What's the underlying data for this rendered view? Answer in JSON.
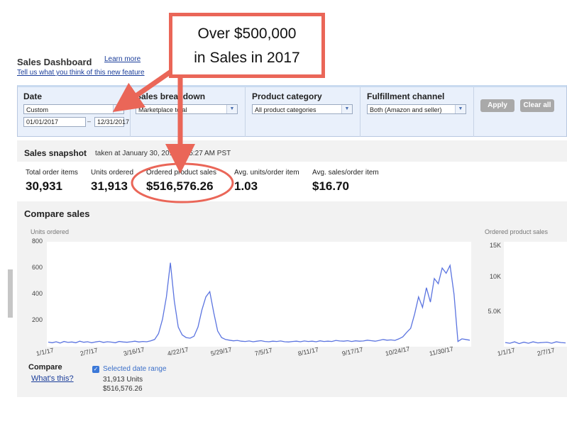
{
  "header": {
    "title": "Sales Dashboard",
    "learn_more": "Learn more",
    "feedback": "Tell us what you think of this new feature"
  },
  "filters": {
    "date": {
      "label": "Date",
      "preset": "Custom",
      "start": "01/01/2017",
      "separator": "–",
      "end": "12/31/2017"
    },
    "breakdown": {
      "label": "Sales breakdown",
      "value": "Marketplace total"
    },
    "category": {
      "label": "Product category",
      "value": "All product categories"
    },
    "fulfillment": {
      "label": "Fulfillment channel",
      "value": "Both (Amazon and seller)"
    },
    "apply_label": "Apply",
    "clear_label": "Clear all"
  },
  "snapshot": {
    "title": "Sales snapshot",
    "subtitle": "taken at January 30, 2018 8:55:27 AM PST",
    "metrics": [
      {
        "label": "Total order items",
        "value": "30,931"
      },
      {
        "label": "Units ordered",
        "value": "31,913"
      },
      {
        "label": "Ordered product sales",
        "value": "$516,576.26"
      },
      {
        "label": "Avg. units/order item",
        "value": "1.03"
      },
      {
        "label": "Avg. sales/order item",
        "value": "$16.70"
      }
    ]
  },
  "compare": {
    "title": "Compare sales",
    "legend_title": "Compare",
    "whats_this": "What's this?",
    "selected_range": "Selected date range",
    "range_units": "31,913 Units",
    "range_sales": "$516,576.26"
  },
  "annotation": {
    "line1": "Over $500,000",
    "line2": "in Sales in 2017",
    "color": "#ea6658"
  },
  "chart_data": [
    {
      "type": "line",
      "ylabel": "Units ordered",
      "ylim": [
        0,
        800
      ],
      "yticks": [
        "200",
        "400",
        "600",
        "800"
      ],
      "x_tick_labels": [
        "1/1/17",
        "2/7/17",
        "3/16/17",
        "4/22/17",
        "5/29/17",
        "7/5/17",
        "8/11/17",
        "9/17/17",
        "10/24/17",
        "11/30/17"
      ],
      "series_color": "#5b74e0",
      "series": [
        {
          "name": "",
          "values": [
            35,
            30,
            38,
            28,
            40,
            33,
            36,
            30,
            42,
            34,
            38,
            30,
            36,
            41,
            33,
            38,
            35,
            30,
            40,
            36,
            34,
            38,
            42,
            36,
            40,
            38,
            45,
            55,
            100,
            210,
            380,
            640,
            350,
            150,
            90,
            70,
            65,
            80,
            150,
            280,
            380,
            420,
            260,
            120,
            70,
            55,
            50,
            45,
            48,
            42,
            40,
            44,
            38,
            42,
            46,
            40,
            38,
            42,
            40,
            44,
            38,
            36,
            40,
            42,
            38,
            44,
            40,
            42,
            38,
            45,
            40,
            42,
            40,
            48,
            44,
            42,
            46,
            40,
            45,
            42,
            44,
            50,
            46,
            42,
            48,
            55,
            50,
            52,
            48,
            60,
            75,
            110,
            140,
            250,
            380,
            300,
            450,
            340,
            520,
            480,
            600,
            560,
            620,
            400,
            40,
            60,
            55,
            50
          ]
        }
      ]
    },
    {
      "type": "line",
      "ylabel": "Ordered product sales",
      "yticks": [
        "5.0K",
        "10K",
        "15K"
      ],
      "x_tick_labels": [
        "1/1/17",
        "2/7/17"
      ],
      "series_color": "#5b74e0",
      "series": [
        {
          "name": "",
          "values": [
            600,
            500,
            700,
            450,
            650,
            500,
            700,
            550,
            600,
            650,
            500,
            700,
            600,
            550
          ]
        }
      ]
    }
  ]
}
